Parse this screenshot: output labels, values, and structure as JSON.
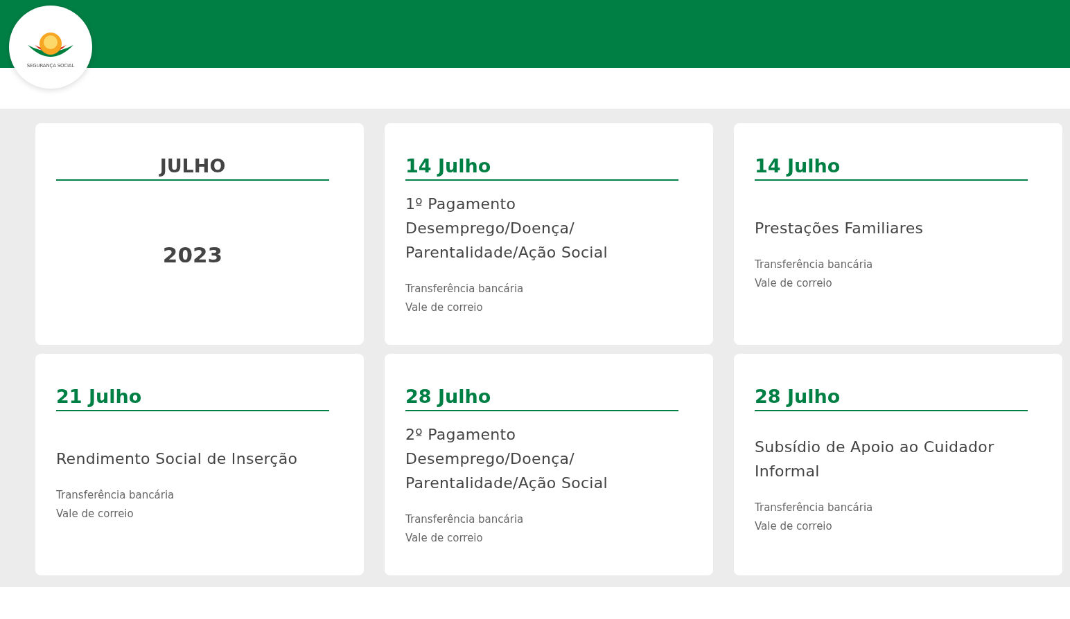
{
  "header": {
    "logo_text": "SEGURANÇA SOCIAL"
  },
  "cards": [
    {
      "kind": "month",
      "title": "JULHO",
      "year": "2023"
    },
    {
      "kind": "payment",
      "title": "14 Julho",
      "description": "1º Pagamento Desemprego/Doença/ Parentalidade/Ação Social",
      "methods": [
        "Transferência bancária",
        "Vale de correio"
      ]
    },
    {
      "kind": "payment",
      "title": "14 Julho",
      "description": "Prestações Familiares",
      "methods": [
        "Transferência bancária",
        "Vale de correio"
      ]
    },
    {
      "kind": "payment",
      "title": "21 Julho",
      "description": "Rendimento Social de Inserção",
      "methods": [
        "Transferência bancária",
        "Vale de correio"
      ]
    },
    {
      "kind": "payment",
      "title": "28 Julho",
      "description": "2º Pagamento Desemprego/Doença/ Parentalidade/Ação Social",
      "methods": [
        "Transferência bancária",
        "Vale de correio"
      ]
    },
    {
      "kind": "payment",
      "title": "28 Julho",
      "description": "Subsídio de Apoio ao Cuidador Informal",
      "methods": [
        "Transferência bancária",
        "Vale de correio"
      ]
    }
  ]
}
